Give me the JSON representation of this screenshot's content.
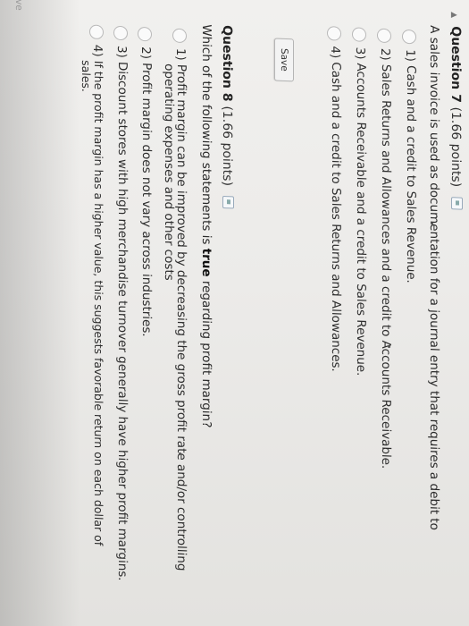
{
  "question7": {
    "title": "Question 7",
    "points": "(1.66 points)",
    "prompt": "A sales invoice is used as documentation for a journal entry that requires a debit to",
    "options": [
      {
        "num": "1)",
        "text": "Cash and a credit to Sales Revenue."
      },
      {
        "num": "2)",
        "text": "Sales Returns and Allowances and a credit to Accounts Receivable."
      },
      {
        "num": "3)",
        "text": "Accounts Receivable and a credit to Sales Revenue."
      },
      {
        "num": "4)",
        "text": "Cash and a credit to Sales Returns and Allowances."
      }
    ],
    "save_label": "Save"
  },
  "question8": {
    "title": "Question 8",
    "points": "(1.66 points)",
    "prompt_before": "Which of the following statements is ",
    "prompt_bold": "true",
    "prompt_after": " regarding profit margin?",
    "options": [
      {
        "num": "1)",
        "line1": "Profit margin can be improved by decreasing the gross profit rate and/or controlling",
        "line2": "operating expenses and other costs"
      },
      {
        "num": "2)",
        "line1": "Profit margin does not vary across industries.",
        "line2": ""
      },
      {
        "num": "3)",
        "line1": "Discount stores with high merchandise turnover generally have higher profit margins.",
        "line2": ""
      },
      {
        "num": "4)",
        "line1": "If the profit margin has a higher value, this suggests favorable return on each dollar of",
        "line2": "sales."
      }
    ],
    "save_label": "Save"
  }
}
